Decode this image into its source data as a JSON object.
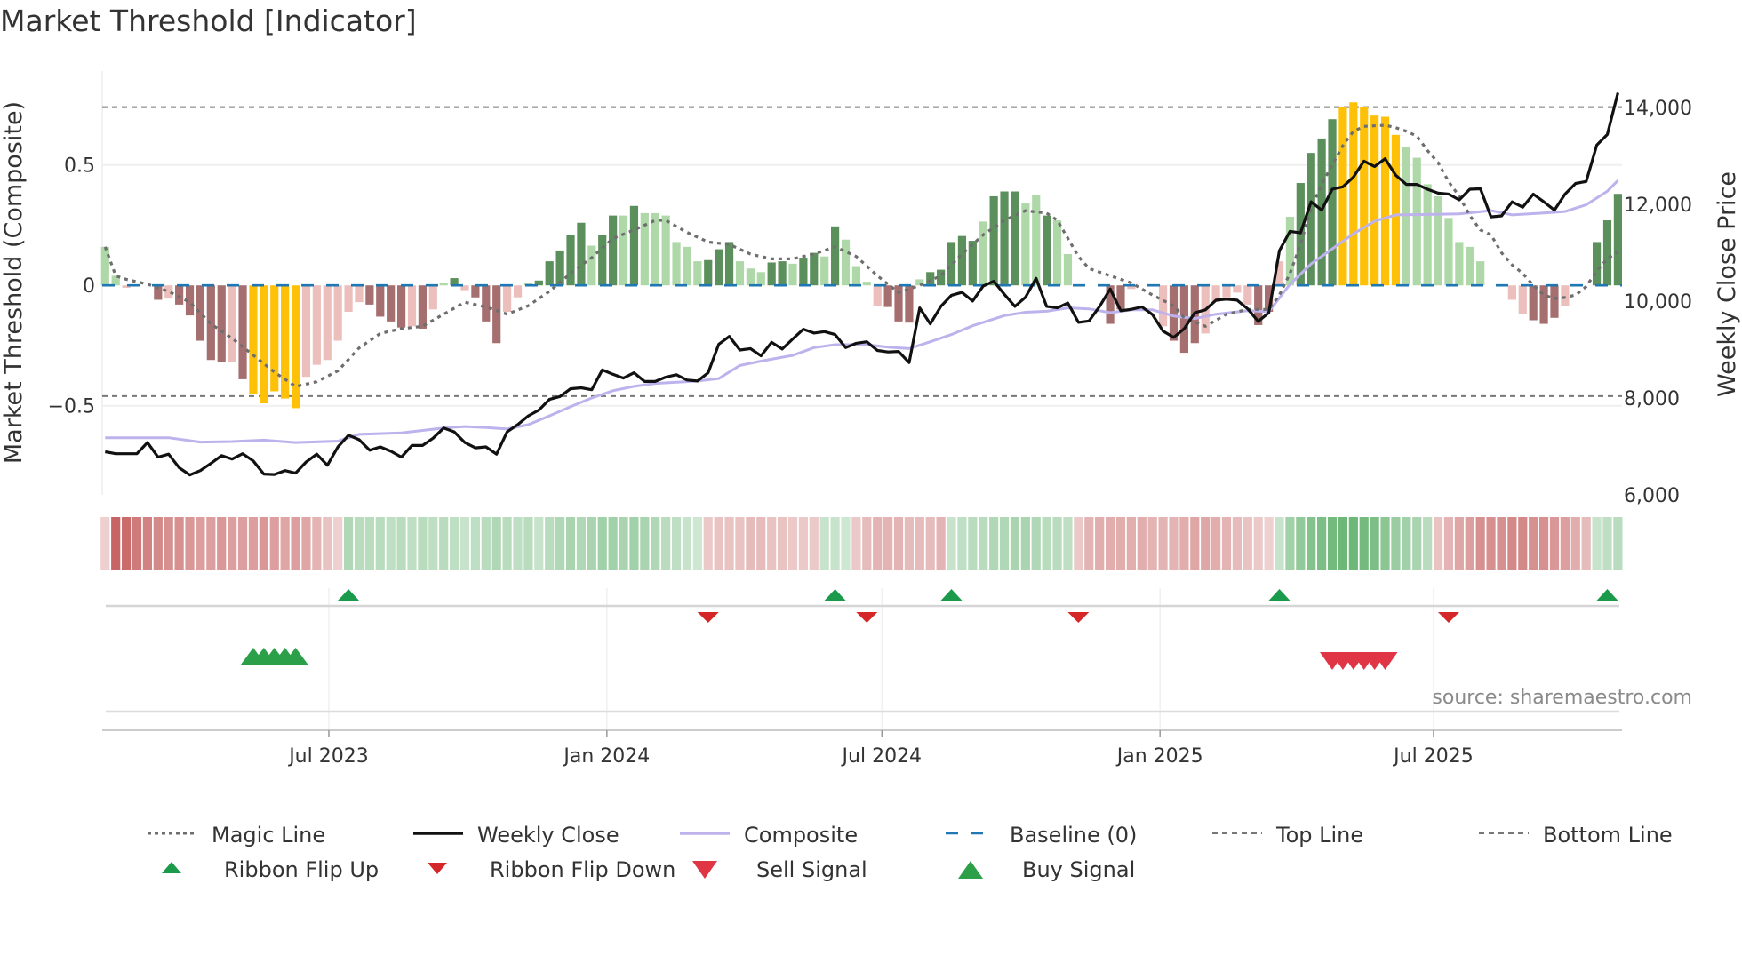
{
  "title": "Market Threshold [Indicator]",
  "source": "source: sharemaestro.com",
  "legend": [
    {
      "label": "Magic Line",
      "icon": "dotted-line"
    },
    {
      "label": "Weekly Close",
      "icon": "solid-line"
    },
    {
      "label": "Composite",
      "icon": "lavender-line"
    },
    {
      "label": "Baseline (0)",
      "icon": "dashed-line"
    },
    {
      "label": "Top Line",
      "icon": "thin-dashed-line"
    },
    {
      "label": "Bottom Line",
      "icon": "thin-dashed-line"
    },
    {
      "label": "Ribbon Flip Up",
      "icon": "triangle-up-icon"
    },
    {
      "label": "Ribbon Flip Down",
      "icon": "triangle-down-icon"
    },
    {
      "label": "Sell Signal",
      "icon": "sell-triangle-icon"
    },
    {
      "label": "Buy Signal",
      "icon": "buy-triangle-icon"
    }
  ],
  "colors": {
    "D": "#5b8f5b",
    "L": "#aed8a8",
    "R": "#a66f6f",
    "P": "#ecbfbc",
    "Y": "#ffc107",
    "close": "#111111",
    "composite": "#bdb2ec",
    "magic": "#6e6e6e",
    "baseline": "#1f77b4",
    "threshold": "#777777",
    "flip_up": "#1a9a4a",
    "flip_down": "#d62728",
    "buy": "#2ca048",
    "sell": "#e03545",
    "ribbon_green": "#4fa85c",
    "ribbon_red": "#c25757"
  },
  "chart_data": {
    "type": "bar",
    "title": "Market Threshold [Indicator]",
    "x_start": "2023-02-03",
    "x_step_days": 7,
    "ylabel": "Market Threshold (Composite)",
    "y2label": "Weekly Close Price",
    "ylim": [
      -0.87,
      0.89
    ],
    "y2lim": [
      6000,
      14750
    ],
    "yticks": [
      {
        "v": 0.5,
        "label": "0.5"
      },
      {
        "v": 0,
        "label": "0"
      },
      {
        "v": -0.5,
        "label": "−0.5"
      }
    ],
    "y2ticks": [
      {
        "v": 14000,
        "label": "14,000"
      },
      {
        "v": 12000,
        "label": "12,000"
      },
      {
        "v": 10000,
        "label": "10,000"
      },
      {
        "v": 8000,
        "label": "8,000"
      },
      {
        "v": 6000,
        "label": "6,000"
      }
    ],
    "xticks": [
      {
        "date": "2023-07-01",
        "label": "Jul 2023"
      },
      {
        "date": "2024-01-01",
        "label": "Jan 2024"
      },
      {
        "date": "2024-07-01",
        "label": "Jul 2024"
      },
      {
        "date": "2025-01-01",
        "label": "Jan 2025"
      },
      {
        "date": "2025-07-01",
        "label": "Jul 2025"
      }
    ],
    "top_line": 0.74,
    "bottom_line": -0.46,
    "baseline": 0,
    "composite_bars": [
      0.16,
      0.04,
      -0.01,
      0,
      0,
      -0.06,
      -0.055,
      -0.08,
      -0.125,
      -0.23,
      -0.31,
      -0.32,
      -0.32,
      -0.39,
      -0.45,
      -0.49,
      -0.44,
      -0.47,
      -0.51,
      -0.38,
      -0.33,
      -0.31,
      -0.23,
      -0.11,
      -0.07,
      -0.08,
      -0.13,
      -0.15,
      -0.175,
      -0.17,
      -0.18,
      -0.1,
      0.01,
      0.03,
      -0.02,
      -0.05,
      -0.15,
      -0.24,
      -0.11,
      -0.05,
      0.01,
      0.02,
      0.1,
      0.145,
      0.21,
      0.26,
      0.165,
      0.21,
      0.29,
      0.29,
      0.33,
      0.3,
      0.3,
      0.29,
      0.18,
      0.16,
      0.1,
      0.105,
      0.15,
      0.18,
      0.1,
      0.07,
      0.055,
      0.095,
      0.1,
      0.09,
      0.115,
      0.135,
      0.12,
      0.245,
      0.19,
      0.08,
      0.015,
      -0.085,
      -0.09,
      -0.15,
      -0.155,
      0.025,
      0.055,
      0.065,
      0.18,
      0.205,
      0.185,
      0.265,
      0.37,
      0.39,
      0.39,
      0.34,
      0.375,
      0.29,
      0.27,
      0.13,
      0,
      0,
      -0.045,
      -0.16,
      -0.1,
      -0.015,
      0,
      -0.07,
      -0.17,
      -0.23,
      -0.28,
      -0.24,
      -0.2,
      -0.07,
      -0.05,
      -0.03,
      -0.08,
      -0.165,
      -0.11,
      0.1,
      0.285,
      0.425,
      0.55,
      0.61,
      0.69,
      0.74,
      0.76,
      0.74,
      0.705,
      0.7,
      0.625,
      0.575,
      0.53,
      0.42,
      0.37,
      0.28,
      0.18,
      0.16,
      0.1,
      0,
      -0.08,
      -0.06,
      -0.12,
      -0.145,
      -0.16,
      -0.135,
      -0.085,
      0,
      0.01,
      0.18,
      0.27,
      0.38
    ],
    "bar_states": "LLPNNRPRRRRRPRYYYYYPPPPPPRRRRPRPLDPRRRPPLDDDDDLDDLDLLLLLLDDDLLLDDLDDLDLLLPRRRLDDDDDLDDDLLDLLLNNRRPPNPRRRPPPPPRRPLDDDDYYYYYYLLLLLLLLLNPPRRRPPNDDDD",
    "weekly_close": [
      6890,
      6850,
      6850,
      6850,
      7080,
      6780,
      6840,
      6560,
      6410,
      6500,
      6650,
      6810,
      6740,
      6850,
      6700,
      6430,
      6420,
      6500,
      6450,
      6680,
      6840,
      6610,
      6990,
      7230,
      7140,
      6920,
      6990,
      6900,
      6780,
      7020,
      7020,
      7170,
      7380,
      7300,
      7080,
      6970,
      6990,
      6840,
      7300,
      7450,
      7630,
      7750,
      7970,
      8030,
      8190,
      8210,
      8170,
      8580,
      8490,
      8410,
      8520,
      8340,
      8340,
      8430,
      8480,
      8370,
      8350,
      8520,
      9110,
      9270,
      8990,
      9020,
      8870,
      9150,
      9010,
      9220,
      9420,
      9340,
      9370,
      9310,
      9040,
      9130,
      9160,
      8980,
      8950,
      8960,
      8730,
      9860,
      9530,
      9890,
      10120,
      10180,
      10000,
      10310,
      10410,
      10140,
      9890,
      10080,
      10470,
      9890,
      9860,
      9960,
      9560,
      9590,
      9890,
      10250,
      9800,
      9830,
      9880,
      9720,
      9380,
      9250,
      9430,
      9760,
      9820,
      10020,
      10040,
      10020,
      9840,
      9580,
      9760,
      11040,
      11440,
      11410,
      12050,
      11880,
      12310,
      12360,
      12560,
      12890,
      12780,
      12940,
      12600,
      12410,
      12410,
      12310,
      12230,
      12210,
      12090,
      12310,
      12320,
      11740,
      11760,
      12050,
      11940,
      12210,
      12050,
      11880,
      12210,
      12430,
      12470,
      13220,
      13440,
      14300
    ],
    "composite_line": [
      [
        0,
        7180
      ],
      [
        6,
        7180
      ],
      [
        9,
        7090
      ],
      [
        12,
        7100
      ],
      [
        15,
        7130
      ],
      [
        18,
        7080
      ],
      [
        22,
        7110
      ],
      [
        24,
        7250
      ],
      [
        28,
        7280
      ],
      [
        32,
        7380
      ],
      [
        34,
        7410
      ],
      [
        36,
        7390
      ],
      [
        38,
        7360
      ],
      [
        40,
        7450
      ],
      [
        42,
        7630
      ],
      [
        44,
        7820
      ],
      [
        46,
        8000
      ],
      [
        48,
        8150
      ],
      [
        50,
        8240
      ],
      [
        52,
        8300
      ],
      [
        56,
        8350
      ],
      [
        58,
        8400
      ],
      [
        60,
        8670
      ],
      [
        62,
        8760
      ],
      [
        65,
        8880
      ],
      [
        67,
        9040
      ],
      [
        69,
        9100
      ],
      [
        72,
        9100
      ],
      [
        74,
        9050
      ],
      [
        76,
        9020
      ],
      [
        78,
        9160
      ],
      [
        80,
        9310
      ],
      [
        82,
        9490
      ],
      [
        85,
        9700
      ],
      [
        87,
        9770
      ],
      [
        89,
        9790
      ],
      [
        91,
        9860
      ],
      [
        93,
        9840
      ],
      [
        95,
        9760
      ],
      [
        97,
        9820
      ],
      [
        99,
        9820
      ],
      [
        101,
        9690
      ],
      [
        103,
        9640
      ],
      [
        105,
        9730
      ],
      [
        108,
        9800
      ],
      [
        110,
        9780
      ],
      [
        112,
        10350
      ],
      [
        114,
        10770
      ],
      [
        116,
        11080
      ],
      [
        118,
        11390
      ],
      [
        120,
        11650
      ],
      [
        122,
        11780
      ],
      [
        125,
        11790
      ],
      [
        128,
        11800
      ],
      [
        131,
        11870
      ],
      [
        133,
        11780
      ],
      [
        136,
        11820
      ],
      [
        138,
        11850
      ],
      [
        140,
        11990
      ],
      [
        142,
        12270
      ],
      [
        143,
        12490
      ]
    ],
    "magic_line": [
      [
        0,
        0.16
      ],
      [
        1,
        0.04
      ],
      [
        2,
        0.025
      ],
      [
        4,
        0.005
      ],
      [
        6,
        -0.025
      ],
      [
        8,
        -0.07
      ],
      [
        10,
        -0.16
      ],
      [
        12,
        -0.22
      ],
      [
        14,
        -0.29
      ],
      [
        16,
        -0.36
      ],
      [
        18,
        -0.42
      ],
      [
        20,
        -0.4
      ],
      [
        22,
        -0.355
      ],
      [
        24,
        -0.26
      ],
      [
        26,
        -0.2
      ],
      [
        28,
        -0.18
      ],
      [
        30,
        -0.17
      ],
      [
        32,
        -0.12
      ],
      [
        34,
        -0.07
      ],
      [
        36,
        -0.09
      ],
      [
        38,
        -0.12
      ],
      [
        40,
        -0.085
      ],
      [
        42,
        -0.025
      ],
      [
        44,
        0.05
      ],
      [
        46,
        0.115
      ],
      [
        48,
        0.195
      ],
      [
        50,
        0.23
      ],
      [
        52,
        0.27
      ],
      [
        53,
        0.27
      ],
      [
        55,
        0.22
      ],
      [
        57,
        0.18
      ],
      [
        59,
        0.17
      ],
      [
        61,
        0.13
      ],
      [
        63,
        0.11
      ],
      [
        65,
        0.11
      ],
      [
        67,
        0.13
      ],
      [
        69,
        0.16
      ],
      [
        71,
        0.12
      ],
      [
        73,
        0.04
      ],
      [
        75,
        -0.03
      ],
      [
        77,
        0
      ],
      [
        79,
        0.04
      ],
      [
        81,
        0.13
      ],
      [
        83,
        0.21
      ],
      [
        85,
        0.27
      ],
      [
        87,
        0.31
      ],
      [
        89,
        0.3
      ],
      [
        90,
        0.27
      ],
      [
        92,
        0.12
      ],
      [
        93,
        0.07
      ],
      [
        95,
        0.04
      ],
      [
        97,
        0.01
      ],
      [
        99,
        -0.04
      ],
      [
        101,
        -0.085
      ],
      [
        102,
        -0.135
      ],
      [
        104,
        -0.17
      ],
      [
        106,
        -0.12
      ],
      [
        108,
        -0.1
      ],
      [
        110,
        -0.1
      ],
      [
        111,
        -0.04
      ],
      [
        112,
        0.05
      ],
      [
        113,
        0.17
      ],
      [
        114,
        0.32
      ],
      [
        115,
        0.42
      ],
      [
        116,
        0.5
      ],
      [
        117,
        0.58
      ],
      [
        118,
        0.64
      ],
      [
        119,
        0.66
      ],
      [
        121,
        0.665
      ],
      [
        122,
        0.655
      ],
      [
        123,
        0.64
      ],
      [
        124,
        0.62
      ],
      [
        125,
        0.56
      ],
      [
        126,
        0.51
      ],
      [
        127,
        0.43
      ],
      [
        128,
        0.37
      ],
      [
        129,
        0.29
      ],
      [
        130,
        0.23
      ],
      [
        131,
        0.21
      ],
      [
        132,
        0.135
      ],
      [
        133,
        0.085
      ],
      [
        134,
        0.05
      ],
      [
        135,
        0
      ],
      [
        136,
        -0.04
      ],
      [
        137,
        -0.055
      ],
      [
        138,
        -0.05
      ],
      [
        139,
        -0.04
      ],
      [
        140,
        -0.005
      ],
      [
        141,
        0.06
      ],
      [
        142,
        0.11
      ],
      [
        143,
        0.14
      ]
    ],
    "ribbon": [
      -0.15,
      -0.9,
      -0.85,
      -0.75,
      -0.7,
      -0.65,
      -0.6,
      -0.6,
      -0.55,
      -0.5,
      -0.5,
      -0.55,
      -0.5,
      -0.5,
      -0.5,
      -0.55,
      -0.5,
      -0.45,
      -0.5,
      -0.45,
      -0.35,
      -0.25,
      -0.15,
      0.35,
      0.3,
      0.3,
      0.3,
      0.25,
      0.3,
      0.25,
      0.3,
      0.25,
      0.3,
      0.25,
      0.2,
      0.25,
      0.3,
      0.35,
      0.3,
      0.25,
      0.3,
      0.2,
      0.3,
      0.35,
      0.4,
      0.35,
      0.4,
      0.45,
      0.45,
      0.4,
      0.45,
      0.4,
      0.35,
      0.3,
      0.25,
      0.2,
      0.15,
      -0.2,
      -0.25,
      -0.25,
      -0.25,
      -0.3,
      -0.3,
      -0.25,
      -0.25,
      -0.2,
      -0.2,
      -0.2,
      0.2,
      0.2,
      0.15,
      -0.2,
      -0.3,
      -0.35,
      -0.35,
      -0.35,
      -0.3,
      -0.3,
      -0.3,
      -0.35,
      0.2,
      0.25,
      0.3,
      0.3,
      0.35,
      0.35,
      0.4,
      0.4,
      0.35,
      0.3,
      0.3,
      0.25,
      -0.2,
      -0.35,
      -0.4,
      -0.4,
      -0.4,
      -0.4,
      -0.4,
      -0.35,
      -0.35,
      -0.35,
      -0.4,
      -0.45,
      -0.45,
      -0.4,
      -0.35,
      -0.3,
      -0.25,
      -0.2,
      -0.15,
      0.2,
      0.45,
      0.55,
      0.65,
      0.7,
      0.75,
      0.8,
      0.8,
      0.75,
      0.7,
      0.6,
      0.5,
      0.45,
      0.4,
      0.3,
      -0.25,
      -0.35,
      -0.45,
      -0.5,
      -0.6,
      -0.6,
      -0.6,
      -0.65,
      -0.65,
      -0.6,
      -0.6,
      -0.55,
      -0.5,
      -0.4,
      -0.3,
      0.2,
      0.25,
      0.3
    ],
    "ribbon_flip_up": [
      23,
      69,
      80,
      111,
      142
    ],
    "ribbon_flip_down": [
      57,
      72,
      92,
      127
    ],
    "buy_signals": [
      14,
      15,
      16,
      17,
      18
    ],
    "sell_signals": [
      116,
      117,
      118,
      119,
      120,
      121
    ]
  }
}
